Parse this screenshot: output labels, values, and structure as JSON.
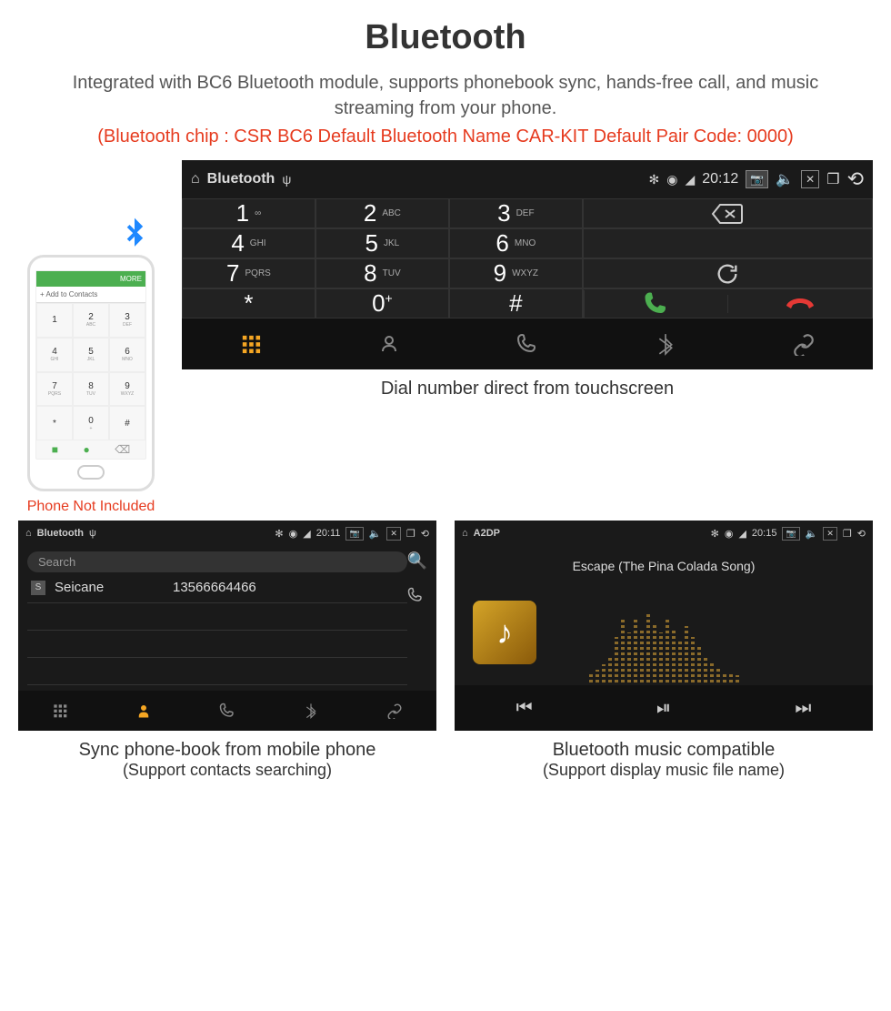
{
  "title": "Bluetooth",
  "subtitle": "Integrated with BC6 Bluetooth module, supports phonebook sync, hands-free call, and music streaming from your phone.",
  "specs": "(Bluetooth chip : CSR BC6     Default Bluetooth Name CAR-KIT     Default Pair Code: 0000)",
  "phone": {
    "topbar": "MORE",
    "add_contacts": "Add to Contacts",
    "keys": [
      {
        "d": "1",
        "s": ""
      },
      {
        "d": "2",
        "s": "ABC"
      },
      {
        "d": "3",
        "s": "DEF"
      },
      {
        "d": "4",
        "s": "GHI"
      },
      {
        "d": "5",
        "s": "JKL"
      },
      {
        "d": "6",
        "s": "MNO"
      },
      {
        "d": "7",
        "s": "PQRS"
      },
      {
        "d": "8",
        "s": "TUV"
      },
      {
        "d": "9",
        "s": "WXYZ"
      },
      {
        "d": "*",
        "s": ""
      },
      {
        "d": "0",
        "s": "+"
      },
      {
        "d": "#",
        "s": ""
      }
    ],
    "caption": "Phone Not Included"
  },
  "dialer": {
    "status_title": "Bluetooth",
    "time": "20:12",
    "keys": [
      {
        "d": "1",
        "s": "∞"
      },
      {
        "d": "2",
        "s": "ABC"
      },
      {
        "d": "3",
        "s": "DEF"
      },
      {
        "d": "4",
        "s": "GHI"
      },
      {
        "d": "5",
        "s": "JKL"
      },
      {
        "d": "6",
        "s": "MNO"
      },
      {
        "d": "7",
        "s": "PQRS"
      },
      {
        "d": "8",
        "s": "TUV"
      },
      {
        "d": "9",
        "s": "WXYZ"
      },
      {
        "d": "*",
        "s": ""
      },
      {
        "d": "0",
        "s": "+"
      },
      {
        "d": "#",
        "s": ""
      }
    ],
    "caption": "Dial number direct from touchscreen"
  },
  "contacts": {
    "status_title": "Bluetooth",
    "time": "20:11",
    "search_placeholder": "Search",
    "contact_badge": "S",
    "contact_name": "Seicane",
    "contact_number": "13566664466",
    "caption_line1": "Sync phone-book from mobile phone",
    "caption_line2": "(Support contacts searching)"
  },
  "music": {
    "status_title": "A2DP",
    "time": "20:15",
    "track": "Escape (The Pina Colada Song)",
    "caption_line1": "Bluetooth music compatible",
    "caption_line2": "(Support display music file name)"
  }
}
